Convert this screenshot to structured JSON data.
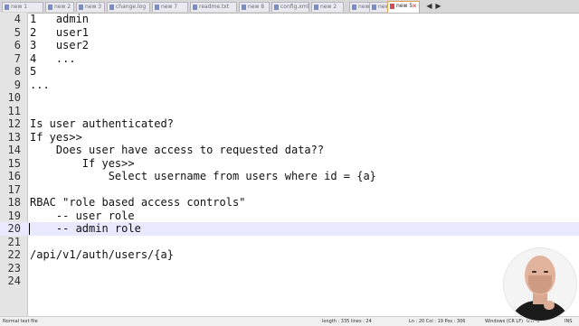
{
  "tabs": [
    {
      "label": "new 1"
    },
    {
      "label": "new 2"
    },
    {
      "label": "new 3"
    },
    {
      "label": "change.log"
    },
    {
      "label": "new 7"
    },
    {
      "label": "readme.txt"
    },
    {
      "label": "new 8"
    },
    {
      "label": "config.xml"
    },
    {
      "label": "new 2"
    },
    {
      "label": "new 1"
    },
    {
      "label": "new 4"
    },
    {
      "label": "new 5",
      "active": true
    }
  ],
  "tab_nav": {
    "prev": "◀",
    "next": "▶",
    "close": "✕"
  },
  "lines": [
    {
      "num": "4",
      "text": "1   admin"
    },
    {
      "num": "5",
      "text": "2   user1"
    },
    {
      "num": "6",
      "text": "3   user2"
    },
    {
      "num": "7",
      "text": "4   ..."
    },
    {
      "num": "8",
      "text": "5"
    },
    {
      "num": "9",
      "text": "..."
    },
    {
      "num": "10",
      "text": ""
    },
    {
      "num": "11",
      "text": ""
    },
    {
      "num": "12",
      "text": "Is user authenticated?"
    },
    {
      "num": "13",
      "text": "If yes>>"
    },
    {
      "num": "14",
      "text": "    Does user have access to requested data??"
    },
    {
      "num": "15",
      "text": "        If yes>>"
    },
    {
      "num": "16",
      "text": "            Select username from users where id = {a}"
    },
    {
      "num": "17",
      "text": ""
    },
    {
      "num": "18",
      "text": "RBAC \"role based access controls\""
    },
    {
      "num": "19",
      "text": "    -- user role"
    },
    {
      "num": "20",
      "text": "    -- admin role"
    },
    {
      "num": "21",
      "text": ""
    },
    {
      "num": "22",
      "text": "/api/v1/auth/users/{a}"
    },
    {
      "num": "23",
      "text": ""
    },
    {
      "num": "24",
      "text": ""
    }
  ],
  "current_line_index": 16,
  "status": {
    "file_type": "Normal text file",
    "length_lines": "length : 335   lines : 24",
    "position": "Ln : 20   Col : 19   Pos : 306",
    "eol": "Windows (CR LF)",
    "encoding": "UTF-8",
    "mode": "INS"
  },
  "colors": {
    "current_line": "#e8e8ff",
    "active_tab_border": "#e0a050",
    "gutter": "#e4e4e4"
  },
  "icons": {
    "tab": "document-icon",
    "close": "close-icon"
  }
}
